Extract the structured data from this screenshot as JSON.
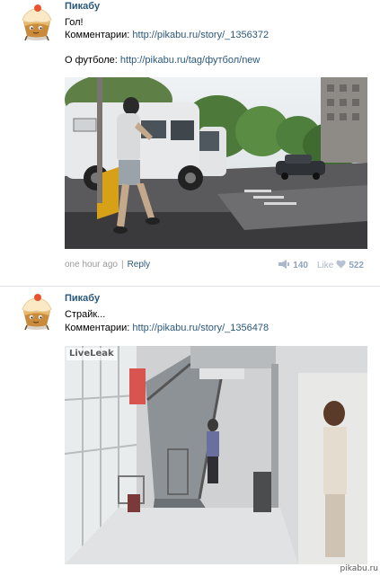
{
  "posts": [
    {
      "author": "Пикабу",
      "lines": {
        "l1": "Гол!",
        "l2_label": "Комментарии: ",
        "l2_link": "http://pikabu.ru/story/_1356372",
        "l3_label": "О футболе: ",
        "l3_link": "http://pikabu.ru/tag/футбол/new"
      },
      "footer": {
        "time": "one hour ago",
        "separator": "|",
        "reply": "Reply",
        "shares": "140",
        "like_label": "Like",
        "likes": "522"
      },
      "media_icon": "street-photo"
    },
    {
      "author": "Пикабу",
      "lines": {
        "l1": "Страйк...",
        "l2_label": "Комментарии: ",
        "l2_link": "http://pikabu.ru/story/_1356478"
      },
      "media_icon": "mall-photo",
      "media_overlay": "LiveLeak"
    }
  ],
  "watermark": "pikabu.ru",
  "colors": {
    "link": "#2b587a",
    "muted": "#999999",
    "counter": "#8fa3b9"
  }
}
